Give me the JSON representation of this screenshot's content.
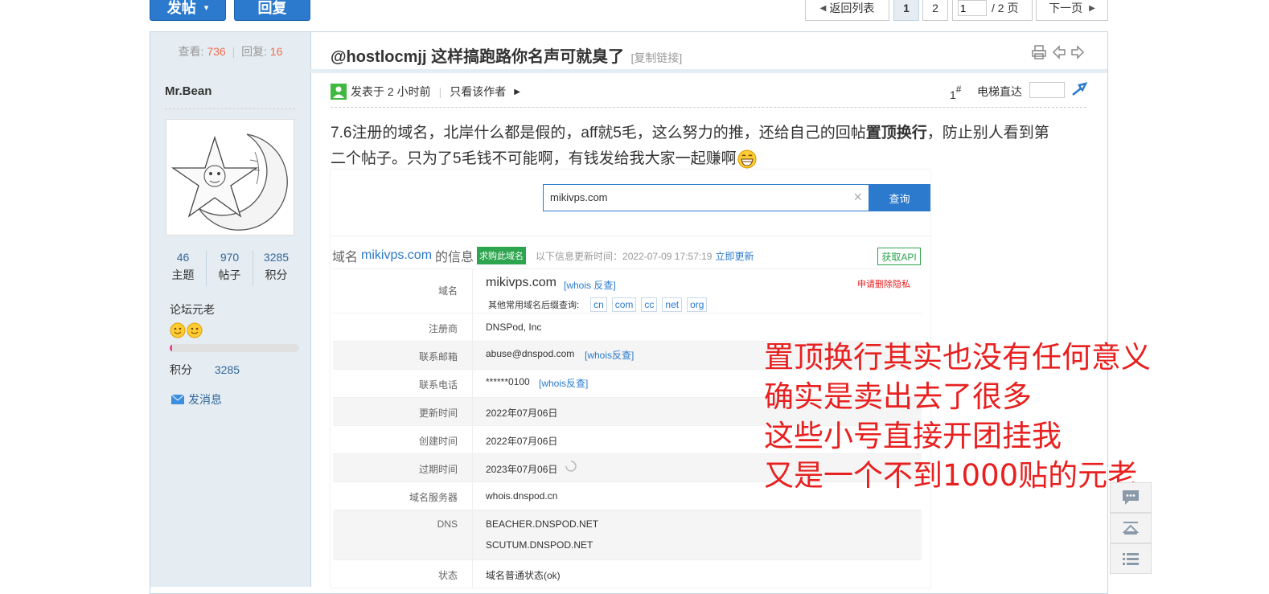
{
  "toolbar": {
    "new_post": "发帖",
    "new_post_caret": "▾",
    "reply": "回复"
  },
  "pager": {
    "back": "返回列表",
    "page1": "1",
    "page2": "2",
    "page_input": "1",
    "total": "/ 2 页",
    "next": "下一页"
  },
  "thread_stats": {
    "views_label": "查看:",
    "views": "736",
    "sep": "|",
    "replies_label": "回复:",
    "replies": "16"
  },
  "thread": {
    "title": "@hostlocmjj 这样搞跑路你名声可就臭了",
    "copy_link": "[复制链接]"
  },
  "author": {
    "name": "Mr.Bean",
    "stats": [
      {
        "value": "46",
        "label": "主题"
      },
      {
        "value": "970",
        "label": "帖子"
      },
      {
        "value": "3285",
        "label": "积分"
      }
    ],
    "rank": "论坛元老",
    "points_label": "积分",
    "points": "3285",
    "message": "发消息"
  },
  "post": {
    "posted": "发表于 2 小时前",
    "divider": "|",
    "only_author": "只看该作者",
    "floor": "1",
    "floor_sign": "#",
    "elevator": "电梯直达",
    "body_line1_a": "7.6注册的域名，北岸什么都是假的，aff就5毛，这么努力的推，还给自己的回帖",
    "body_line1_bold": "置顶换行",
    "body_line1_b": "，防止别人看到第",
    "body_line2": "二个帖子。只为了5毛钱不可能啊，有钱发给我大家一起赚啊"
  },
  "whois": {
    "search_value": "mikivps.com",
    "search_btn": "查询",
    "info_prefix": "域名",
    "domain": "mikivps.com",
    "info_suffix": "的信息",
    "buy_badge": "求购此域名",
    "updated_text": "以下信息更新时间：2022-07-09 17:57:19",
    "refresh": "立即更新",
    "api_btn": "获取API",
    "domain_label": "域名",
    "whois_link": "[whois 反查]",
    "privacy": "申请删除隐私",
    "suffix_label": "其他常用域名后缀查询:",
    "suffixes": [
      "cn",
      "com",
      "cc",
      "net",
      "org"
    ],
    "rows": [
      {
        "label": "注册商",
        "value": "DNSPod, Inc",
        "link": ""
      },
      {
        "label": "联系邮箱",
        "value": "abuse@dnspod.com",
        "link": "[whois反查]"
      },
      {
        "label": "联系电话",
        "value": "******0100",
        "link": "[whois反查]"
      },
      {
        "label": "更新时间",
        "value": "2022年07月06日",
        "link": ""
      },
      {
        "label": "创建时间",
        "value": "2022年07月06日",
        "link": ""
      },
      {
        "label": "过期时间",
        "value": "2023年07月06日",
        "link": ""
      },
      {
        "label": "域名服务器",
        "value": "whois.dnspod.cn",
        "link": ""
      }
    ],
    "dns_label": "DNS",
    "dns": [
      "BEACHER.DNSPOD.NET",
      "SCUTUM.DNSPOD.NET"
    ],
    "status_label": "状态",
    "status_value": "域名普通状态(ok)"
  },
  "annotation": [
    "置顶换行其实也没有任何意义",
    "确实是卖出去了很多",
    "这些小号直接开团挂我",
    "又是一个不到1000贴的元老"
  ],
  "colors": {
    "accent": "#2b7acd",
    "stat_orange": "#f26c4f",
    "annotation": "#e82020",
    "sidebar_bg": "#e5edf2"
  }
}
